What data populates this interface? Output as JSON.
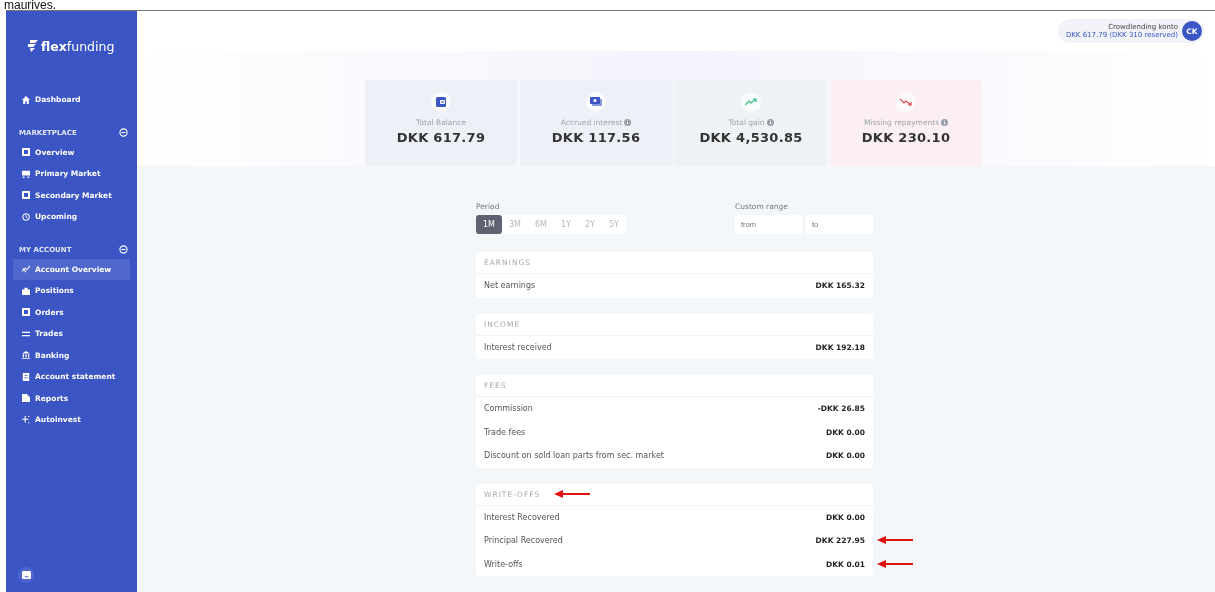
{
  "caption": "maurives.",
  "sidebar": {
    "logo_bold": "flex",
    "logo_rest": "funding",
    "items": [
      {
        "kind": "link",
        "label": "Dashboard",
        "selected": false
      },
      {
        "kind": "section",
        "label": "MARKETPLACE",
        "expanded": true
      },
      {
        "kind": "link",
        "label": "Overview",
        "selected": false
      },
      {
        "kind": "link",
        "label": "Primary Market",
        "selected": false
      },
      {
        "kind": "link",
        "label": "Secondary Market",
        "selected": false
      },
      {
        "kind": "link",
        "label": "Upcoming",
        "selected": false
      },
      {
        "kind": "section",
        "label": "MY ACCOUNT",
        "expanded": true
      },
      {
        "kind": "link",
        "label": "Account Overview",
        "selected": true
      },
      {
        "kind": "link",
        "label": "Positions",
        "selected": false
      },
      {
        "kind": "link",
        "label": "Orders",
        "selected": false
      },
      {
        "kind": "link",
        "label": "Trades",
        "selected": false
      },
      {
        "kind": "link",
        "label": "Banking",
        "selected": false
      },
      {
        "kind": "link",
        "label": "Account statement",
        "selected": false
      },
      {
        "kind": "link",
        "label": "Reports",
        "selected": false
      },
      {
        "kind": "link",
        "label": "Autoinvest",
        "selected": false
      }
    ]
  },
  "account": {
    "name": "Crowdlending konto",
    "detail": "DKK 617.79 (DKK 310 reserved)",
    "initials": "CK"
  },
  "stats": [
    {
      "kind": "wallet",
      "label": "Total Balance",
      "info": false,
      "value": "DKK 617.79"
    },
    {
      "kind": "cash",
      "label": "Accrued interest",
      "info": true,
      "value": "DKK 117.56"
    },
    {
      "kind": "up",
      "label": "Total gain",
      "info": true,
      "value": "DKK 4,530.85"
    },
    {
      "kind": "down",
      "label": "Missing repayments",
      "info": true,
      "value": "DKK 230.10"
    }
  ],
  "period": {
    "label": "Period",
    "options": [
      {
        "label": "1M",
        "selected": true
      },
      {
        "label": "3M",
        "selected": false
      },
      {
        "label": "6M",
        "selected": false
      },
      {
        "label": "1Y",
        "selected": false
      },
      {
        "label": "2Y",
        "selected": false
      },
      {
        "label": "5Y",
        "selected": false
      }
    ]
  },
  "custom_range": {
    "label": "Custom range",
    "from_placeholder": "from",
    "to_placeholder": "to"
  },
  "sections": [
    {
      "title": "EARNINGS",
      "marked": false,
      "rows": [
        {
          "label": "Net earnings",
          "value": "DKK 165.32",
          "marked": false
        }
      ]
    },
    {
      "title": "INCOME",
      "marked": false,
      "rows": [
        {
          "label": "Interest received",
          "value": "DKK 192.18",
          "marked": false
        }
      ]
    },
    {
      "title": "FEES",
      "marked": false,
      "rows": [
        {
          "label": "Commission",
          "value": "-DKK 26.85",
          "marked": false
        },
        {
          "label": "Trade fees",
          "value": "DKK 0.00",
          "marked": false
        },
        {
          "label": "Discount on sold loan parts from sec. market",
          "value": "DKK 0.00",
          "marked": false
        }
      ]
    },
    {
      "title": "WRITE-OFFS",
      "marked": true,
      "rows": [
        {
          "label": "Interest Recovered",
          "value": "DKK 0.00",
          "marked": false
        },
        {
          "label": "Principal Recovered",
          "value": "DKK 227.95",
          "marked": true
        },
        {
          "label": "Write-offs",
          "value": "DKK 0.01",
          "marked": true
        }
      ]
    }
  ]
}
